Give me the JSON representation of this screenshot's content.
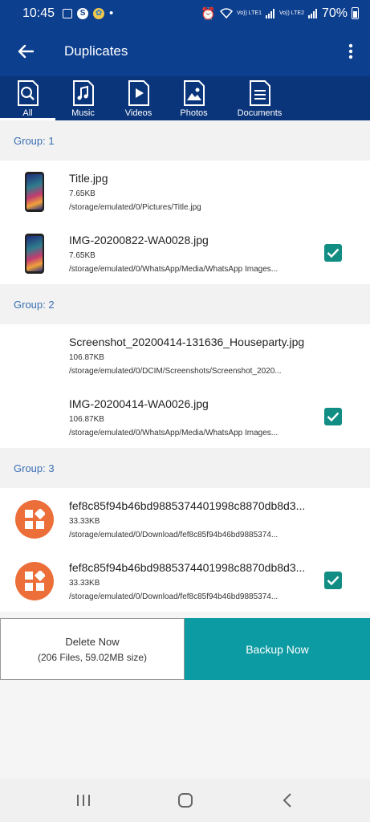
{
  "status": {
    "time": "10:45",
    "battery": "70%",
    "sim1": "Vo)) LTE1",
    "sim2": "Vo)) LTE2"
  },
  "appbar": {
    "title": "Duplicates"
  },
  "tabs": [
    {
      "label": "All",
      "icon": "search-file-icon",
      "active": true
    },
    {
      "label": "Music",
      "icon": "music-file-icon"
    },
    {
      "label": "Videos",
      "icon": "video-file-icon"
    },
    {
      "label": "Photos",
      "icon": "photo-file-icon"
    },
    {
      "label": "Documents",
      "icon": "document-file-icon"
    }
  ],
  "groups": [
    {
      "label": "Group: 1",
      "items": [
        {
          "name": "Title.jpg",
          "size": "7.65KB",
          "path": "/storage/emulated/0/Pictures/Title.jpg",
          "checked": false
        },
        {
          "name": "IMG-20200822-WA0028.jpg",
          "size": "7.65KB",
          "path": "/storage/emulated/0/WhatsApp/Media/WhatsApp Images...",
          "checked": true
        }
      ]
    },
    {
      "label": "Group: 2",
      "items": [
        {
          "name": "Screenshot_20200414-131636_Houseparty.jpg",
          "size": "106.87KB",
          "path": "/storage/emulated/0/DCIM/Screenshots/Screenshot_2020...",
          "checked": false
        },
        {
          "name": "IMG-20200414-WA0026.jpg",
          "size": "106.87KB",
          "path": "/storage/emulated/0/WhatsApp/Media/WhatsApp Images...",
          "checked": true
        }
      ]
    },
    {
      "label": "Group: 3",
      "items": [
        {
          "name": "fef8c85f94b46bd9885374401998c8870db8d3...",
          "size": "33.33KB",
          "path": "/storage/emulated/0/Download/fef8c85f94b46bd9885374...",
          "checked": false
        },
        {
          "name": "fef8c85f94b46bd9885374401998c8870db8d3...",
          "size": "33.33KB",
          "path": "/storage/emulated/0/Download/fef8c85f94b46bd9885374...",
          "checked": true
        }
      ]
    }
  ],
  "actions": {
    "delete_label": "Delete Now",
    "delete_sub": "(206 Files, 59.02MB size)",
    "backup_label": "Backup Now"
  },
  "colors": {
    "primary": "#0d3f8f",
    "tabs_bg": "#0a357a",
    "accent": "#0d9ba3",
    "check": "#118d84",
    "group_label": "#3a6fb3"
  }
}
